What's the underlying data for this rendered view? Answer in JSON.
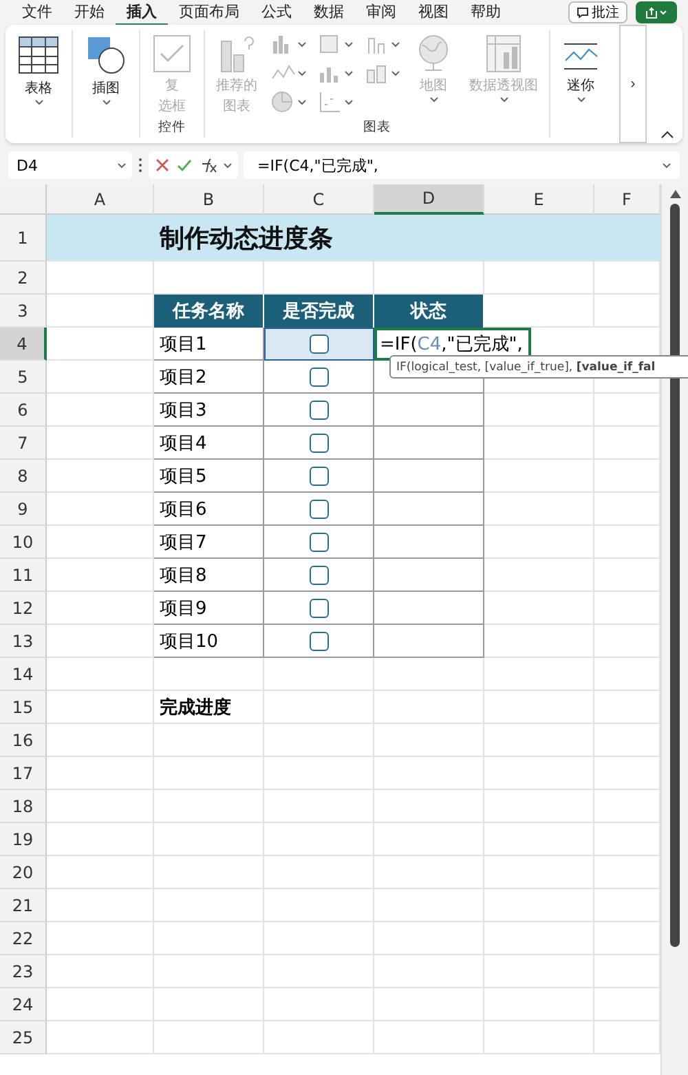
{
  "menu_tabs": [
    {
      "label": "文件",
      "selected": false
    },
    {
      "label": "开始",
      "selected": false
    },
    {
      "label": "插入",
      "selected": true
    },
    {
      "label": "页面布局",
      "selected": false
    },
    {
      "label": "公式",
      "selected": false
    },
    {
      "label": "数据",
      "selected": false
    },
    {
      "label": "审阅",
      "selected": false
    },
    {
      "label": "视图",
      "selected": false
    },
    {
      "label": "帮助",
      "selected": false
    }
  ],
  "comment_button": "批注",
  "ribbon": {
    "table": "表格",
    "illustrations": "插图",
    "controls": {
      "item_lines": [
        "复",
        "选框"
      ],
      "disabled": true,
      "group_label": "控件"
    },
    "charts": {
      "recommended_lines": [
        "推荐的",
        "图表"
      ],
      "map": "地图",
      "pivot_chart": "数据透视图",
      "disabled": true,
      "group_label": "图表"
    },
    "sparklines": "迷你",
    "scroll_glyph": "›"
  },
  "formula_bar": {
    "name_box": "D4",
    "formula": "=IF(C4,\"已完成\","
  },
  "sheet": {
    "columns": [
      {
        "label": "A",
        "selected": false
      },
      {
        "label": "B",
        "selected": false
      },
      {
        "label": "C",
        "selected": false
      },
      {
        "label": "D",
        "selected": true
      },
      {
        "label": "E",
        "selected": false
      },
      {
        "label": "F",
        "selected": false
      }
    ],
    "row_numbers": [
      {
        "label": "1",
        "selected": false
      },
      {
        "label": "2",
        "selected": false
      },
      {
        "label": "3",
        "selected": false
      },
      {
        "label": "4",
        "selected": true
      },
      {
        "label": "5",
        "selected": false
      },
      {
        "label": "6",
        "selected": false
      },
      {
        "label": "7",
        "selected": false
      },
      {
        "label": "8",
        "selected": false
      },
      {
        "label": "9",
        "selected": false
      },
      {
        "label": "10",
        "selected": false
      },
      {
        "label": "11",
        "selected": false
      },
      {
        "label": "12",
        "selected": false
      },
      {
        "label": "13",
        "selected": false
      },
      {
        "label": "14",
        "selected": false
      },
      {
        "label": "15",
        "selected": false
      },
      {
        "label": "16",
        "selected": false
      },
      {
        "label": "17",
        "selected": false
      },
      {
        "label": "18",
        "selected": false
      },
      {
        "label": "19",
        "selected": false
      },
      {
        "label": "20",
        "selected": false
      },
      {
        "label": "21",
        "selected": false
      },
      {
        "label": "22",
        "selected": false
      },
      {
        "label": "23",
        "selected": false
      },
      {
        "label": "24",
        "selected": false
      },
      {
        "label": "25",
        "selected": false
      }
    ],
    "title": "制作动态进度条",
    "headers": [
      "任务名称",
      "是否完成",
      "状态"
    ],
    "tasks": [
      {
        "name": "项目1",
        "checked": false,
        "selected": true
      },
      {
        "name": "项目2",
        "checked": false,
        "selected": false
      },
      {
        "name": "项目3",
        "checked": false,
        "selected": false
      },
      {
        "name": "项目4",
        "checked": false,
        "selected": false
      },
      {
        "name": "项目5",
        "checked": false,
        "selected": false
      },
      {
        "name": "项目6",
        "checked": false,
        "selected": false
      },
      {
        "name": "项目7",
        "checked": false,
        "selected": false
      },
      {
        "name": "项目8",
        "checked": false,
        "selected": false
      },
      {
        "name": "项目9",
        "checked": false,
        "selected": false
      },
      {
        "name": "项目10",
        "checked": false,
        "selected": false
      }
    ],
    "editing_cell": {
      "parts": [
        {
          "kind": "plain",
          "text": "=IF("
        },
        {
          "kind": "reference",
          "text": "C4"
        },
        {
          "kind": "plain",
          "text": ",\"已完成\","
        }
      ],
      "tooltip": "IF(logical_test, [value_if_true], **[value_if_fal**"
    },
    "progress_label": "完成进度"
  }
}
